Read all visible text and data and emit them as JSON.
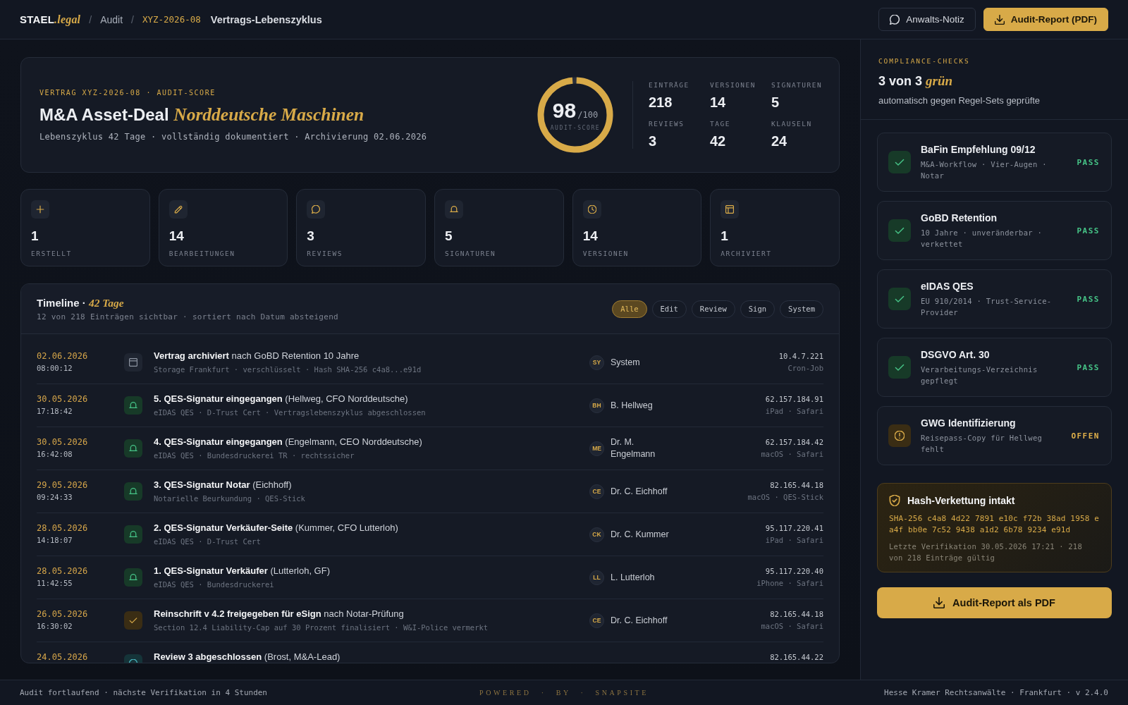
{
  "header": {
    "brand": {
      "name": "STAEL",
      "suffix": ".legal"
    },
    "separator": "/",
    "breadcrumb": [
      {
        "label": "Audit",
        "kind": "link"
      },
      {
        "label": "XYZ-2026-08",
        "kind": "code"
      }
    ],
    "page_title": "Vertrags-Lebenszyklus",
    "buttons": [
      {
        "label": "Anwalts-Notiz",
        "kind": "note"
      },
      {
        "label": "Audit-Report (PDF)",
        "kind": "download"
      }
    ]
  },
  "contract": {
    "eyebrow": "VERTRAG XYZ-2026-08 · AUDIT-SCORE",
    "title": "M&A Asset-Deal",
    "title_accent": "Norddeutsche Maschinen",
    "subtitle": "Lebenszyklus 42 Tage · vollständig dokumentiert · Archivierung 02.06.2026",
    "score": {
      "value": "98",
      "max": "/100",
      "label": "AUDIT-SCORE",
      "level": 0.98
    },
    "stats": [
      {
        "label": "EINTRÄGE",
        "value": "218"
      },
      {
        "label": "VERSIONEN",
        "value": "14"
      },
      {
        "label": "SIGNATUREN",
        "value": "5"
      },
      {
        "label": "REVIEWS",
        "value": "3"
      },
      {
        "label": "TAGE",
        "value": "42"
      },
      {
        "label": "KLAUSELN",
        "value": "24"
      }
    ]
  },
  "counters": [
    {
      "kind": "created",
      "value": "1",
      "label": "ERSTELLT"
    },
    {
      "kind": "edit",
      "value": "14",
      "label": "BEARBEITUNGEN"
    },
    {
      "kind": "review",
      "value": "3",
      "label": "REVIEWS"
    },
    {
      "kind": "sign",
      "value": "5",
      "label": "SIGNATUREN"
    },
    {
      "kind": "version",
      "value": "14",
      "label": "VERSIONEN"
    },
    {
      "kind": "archive",
      "value": "1",
      "label": "ARCHIVIERT"
    }
  ],
  "timeline": {
    "title": "Timeline ·",
    "title_accent": "42 Tage",
    "subtitle": "12 von 218 Einträgen sichtbar · sortiert nach Datum absteigend",
    "filters": [
      {
        "label": "Alle",
        "selected": true
      },
      {
        "label": "Edit",
        "selected": false
      },
      {
        "label": "Review",
        "selected": false
      },
      {
        "label": "Sign",
        "selected": false
      },
      {
        "label": "System",
        "selected": false
      }
    ],
    "entries": [
      {
        "kind": "archive",
        "date": "02.06.2026",
        "time": "08:00:12",
        "title": "**Vertrag archiviert** nach GoBD Retention 10 Jahre",
        "details": "Storage Frankfurt · verschlüsselt · Hash SHA-256 c4a8...e91d",
        "initials": "SY",
        "actor": "System",
        "ip": "10.4.7.221",
        "device": "Cron-Job"
      },
      {
        "kind": "sign",
        "date": "30.05.2026",
        "time": "17:18:42",
        "title": "**5. QES-Signatur eingegangen** (Hellweg, CFO Norddeutsche)",
        "details": "eIDAS QES · D-Trust Cert · Vertragslebenszyklus abgeschlossen",
        "initials": "BH",
        "actor": "B. Hellweg",
        "ip": "62.157.184.91",
        "device": "iPad · Safari"
      },
      {
        "kind": "sign",
        "date": "30.05.2026",
        "time": "16:42:08",
        "title": "**4. QES-Signatur eingegangen** (Engelmann, CEO Norddeutsche)",
        "details": "eIDAS QES · Bundesdruckerei TR · rechtssicher",
        "initials": "ME",
        "actor": "Dr. M. Engelmann",
        "ip": "62.157.184.42",
        "device": "macOS · Safari"
      },
      {
        "kind": "sign",
        "date": "29.05.2026",
        "time": "09:24:33",
        "title": "**3. QES-Signatur Notar** (Eichhoff)",
        "details": "Notarielle Beurkundung · QES-Stick",
        "initials": "CE",
        "actor": "Dr. C. Eichhoff",
        "ip": "82.165.44.18",
        "device": "macOS · QES-Stick"
      },
      {
        "kind": "sign",
        "date": "28.05.2026",
        "time": "14:18:07",
        "title": "**2. QES-Signatur Verkäufer-Seite** (Kummer, CFO Lutterloh)",
        "details": "eIDAS QES · D-Trust Cert",
        "initials": "CK",
        "actor": "Dr. C. Kummer",
        "ip": "95.117.220.41",
        "device": "iPad · Safari"
      },
      {
        "kind": "sign",
        "date": "28.05.2026",
        "time": "11:42:55",
        "title": "**1. QES-Signatur Verkäufer** (Lutterloh, GF)",
        "details": "eIDAS QES · Bundesdruckerei",
        "initials": "LL",
        "actor": "L. Lutterloh",
        "ip": "95.117.220.40",
        "device": "iPhone · Safari"
      },
      {
        "kind": "approve",
        "date": "26.05.2026",
        "time": "16:30:02",
        "title": "**Reinschrift v 4.2 freigegeben für eSign** nach Notar-Prüfung",
        "details": "Section 12.4 Liability-Cap auf 30 Prozent finalisiert · W&I-Police vermerkt",
        "initials": "CE",
        "actor": "Dr. C. Eichhoff",
        "ip": "82.165.44.18",
        "device": "macOS · Safari"
      },
      {
        "kind": "review",
        "date": "24.05.2026",
        "title": "**Review 3 abgeschlossen** (Brost, M&A-Lead)",
        "ip": "82.165.44.22"
      }
    ]
  },
  "compliance": {
    "eyebrow": "COMPLIANCE-CHECKS",
    "title": "3 von 3",
    "title_accent": "grün",
    "subtitle": "automatisch gegen Regel-Sets geprüfte",
    "checks": [
      {
        "kind": "pass",
        "title": "BaFin Empfehlung 09/12",
        "details": "M&A-Workflow · Vier-Augen · Notar",
        "status": "PASS"
      },
      {
        "kind": "pass",
        "title": "GoBD Retention",
        "details": "10 Jahre · unveränderbar · verkettet",
        "status": "PASS"
      },
      {
        "kind": "pass",
        "title": "eIDAS QES",
        "details": "EU 910/2014 · Trust-Service-Provider",
        "status": "PASS"
      },
      {
        "kind": "pass",
        "title": "DSGVO Art. 30",
        "details": "Verarbeitungs-Verzeichnis gepflegt",
        "status": "PASS"
      },
      {
        "kind": "open",
        "title": "GWG Identifizierung",
        "details": "Reisepass-Copy für Hellweg fehlt",
        "status": "OFFEN"
      }
    ]
  },
  "hash": {
    "title": "Hash-Verkettung intakt",
    "value": "SHA-256 c4a8 4d22 7891 e10c f72b 38ad 1958 ea4f bb0e 7c52 9438 a1d2 6b78 9234 e91d",
    "note": "Letzte Verifikation 30.05.2026 17:21 · 218 von 218 Einträge gültig"
  },
  "export_button": {
    "label": "Audit-Report als PDF"
  },
  "footer": {
    "left": "Audit fortlaufend · nächste Verifikation in 4 Stunden",
    "center": "POWERED · BY · SNAPSITE",
    "right": "Hesse Kramer Rechtsanwälte · Frankfurt · v 2.4.0"
  }
}
